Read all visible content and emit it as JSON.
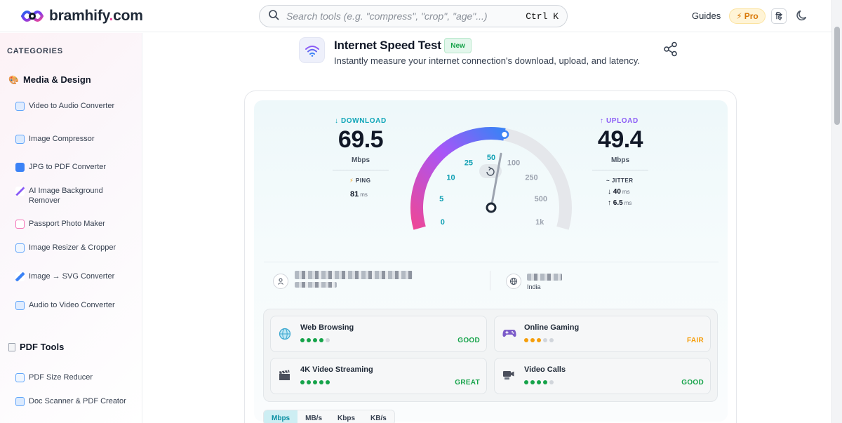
{
  "header": {
    "brand_name": "bramhify",
    "brand_dot": ".",
    "brand_tld": "com",
    "search_placeholder": "Search tools (e.g. \"compress\", \"crop\", \"age\"...)",
    "search_shortcut": "Ctrl K",
    "guides_label": "Guides",
    "pro_label": "Pro",
    "lang_label": "हि"
  },
  "sidebar": {
    "categories_title": "CATEGORIES",
    "sections": [
      {
        "label": "Media & Design",
        "items": [
          {
            "label": "Video to Audio Converter",
            "color": "#60a5fa"
          },
          {
            "label": "Image Compressor",
            "color": "#60a5fa"
          },
          {
            "label": "JPG to PDF Converter",
            "color": "#3b82f6"
          },
          {
            "label": "AI Image Background Remover",
            "color": "#8b5cf6"
          },
          {
            "label": "Passport Photo Maker",
            "color": "#f472b6"
          },
          {
            "label": "Image Resizer & Cropper",
            "color": "#60a5fa"
          },
          {
            "label": "Image → SVG Converter",
            "color": "#3b82f6"
          },
          {
            "label": "Audio to Video Converter",
            "color": "#60a5fa"
          }
        ]
      },
      {
        "label": "PDF Tools",
        "items": [
          {
            "label": "PDF Size Reducer",
            "color": "#60a5fa"
          },
          {
            "label": "Doc Scanner & PDF Creator",
            "color": "#60a5fa"
          }
        ]
      }
    ]
  },
  "tool": {
    "title": "Internet Speed Test",
    "badge": "New",
    "subtitle": "Instantly measure your internet connection's download, upload, and latency."
  },
  "speed": {
    "download_label": "DOWNLOAD",
    "download_value": "69.5",
    "download_unit": "Mbps",
    "ping_label": "PING",
    "ping_value": "81",
    "ping_unit": "ms",
    "upload_label": "UPLOAD",
    "upload_value": "49.4",
    "upload_unit": "Mbps",
    "jitter_label": "JITTER",
    "jitter_down": "40",
    "jitter_up": "6.5",
    "jitter_unit": "ms"
  },
  "gauge": {
    "scale_labels": [
      "0",
      "5",
      "10",
      "25",
      "50",
      "100",
      "250",
      "500",
      "1k"
    ],
    "needle_value_mbps": 69.5,
    "accent_from": "#ec4899",
    "accent_to": "#3b82f6"
  },
  "connection": {
    "country": "India"
  },
  "quality": [
    {
      "name": "Web Browsing",
      "rating": "GOOD",
      "dots": 4,
      "color": "#16a34a",
      "icon": "globe-icon"
    },
    {
      "name": "Online Gaming",
      "rating": "FAIR",
      "dots": 3,
      "color": "#f59e0b",
      "icon": "gamepad-icon"
    },
    {
      "name": "4K Video Streaming",
      "rating": "GREAT",
      "dots": 5,
      "color": "#16a34a",
      "icon": "clapper-icon"
    },
    {
      "name": "Video Calls",
      "rating": "GOOD",
      "dots": 4,
      "color": "#16a34a",
      "icon": "video-call-icon"
    }
  ],
  "units": {
    "options": [
      "Mbps",
      "MB/s",
      "Kbps",
      "KB/s"
    ],
    "selected": "Mbps"
  }
}
